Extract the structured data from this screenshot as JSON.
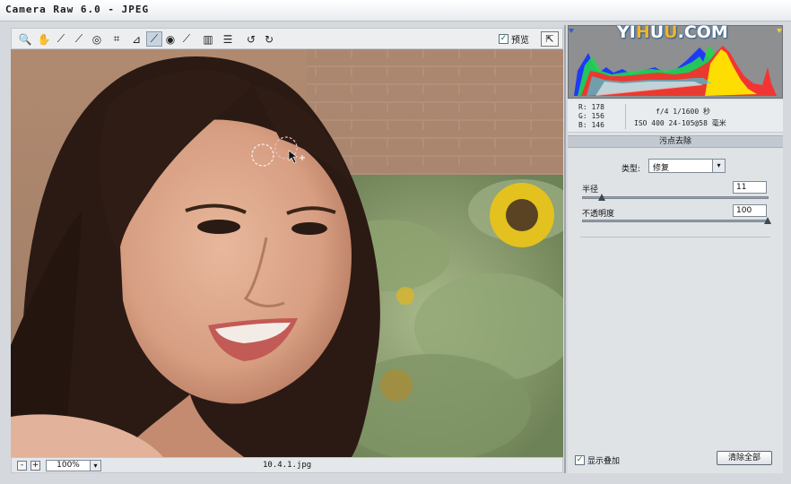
{
  "window": {
    "title": "Camera Raw 6.0 -  JPEG"
  },
  "watermark": {
    "pre": "YI",
    "hl1": "H",
    "mid": "U",
    "hl2": "U",
    ".com": "",
    "post": ".COM"
  },
  "toolbar": {
    "tools": [
      {
        "name": "zoom-tool-icon",
        "glyph": "🔍"
      },
      {
        "name": "hand-tool-icon",
        "glyph": "✋"
      },
      {
        "name": "white-balance-tool-icon",
        "glyph": "⟋"
      },
      {
        "name": "color-sampler-tool-icon",
        "glyph": "⟋"
      },
      {
        "name": "targeted-adjustment-tool-icon",
        "glyph": "◎"
      },
      {
        "name": "crop-tool-icon",
        "glyph": "⌗"
      },
      {
        "name": "straighten-tool-icon",
        "glyph": "⊿"
      },
      {
        "name": "spot-removal-tool-icon",
        "glyph": "⟋"
      },
      {
        "name": "red-eye-tool-icon",
        "glyph": "◉"
      },
      {
        "name": "adjustment-brush-icon",
        "glyph": "⟋"
      },
      {
        "name": "graduated-filter-icon",
        "glyph": "▥"
      },
      {
        "name": "preferences-icon",
        "glyph": "☰"
      },
      {
        "name": "rotate-left-icon",
        "glyph": "↺"
      },
      {
        "name": "rotate-right-icon",
        "glyph": "↻"
      }
    ],
    "preview_label": "预览",
    "preview_checked": "✓"
  },
  "status": {
    "zoom_out": "-",
    "zoom_in": "+",
    "zoom_value": "100%",
    "zoom_dropdown": "▾",
    "filename": "10.4.1.jpg"
  },
  "info": {
    "r": "R:  178",
    "g": "G:  156",
    "b": "B:  146",
    "exif_line1": "f/4   1/1600 秒",
    "exif_line2": "ISO 400   24-105@58 毫米"
  },
  "spot_removal": {
    "header": "污点去除",
    "type_label": "类型:",
    "type_value": "修复",
    "type_dropdown": "▾",
    "radius_label": "半径",
    "radius_value": "11",
    "radius_fraction": 0.1,
    "opacity_label": "不透明度",
    "opacity_value": "100",
    "opacity_fraction": 1.0,
    "show_overlay_label": "显示叠加",
    "show_overlay_checked": "✓",
    "clear_all_label": "清除全部"
  },
  "colors": {
    "histogram_bg": "#8d8f91",
    "panel_bg": "#dfe3e6",
    "accent": "#2c5d8f"
  }
}
